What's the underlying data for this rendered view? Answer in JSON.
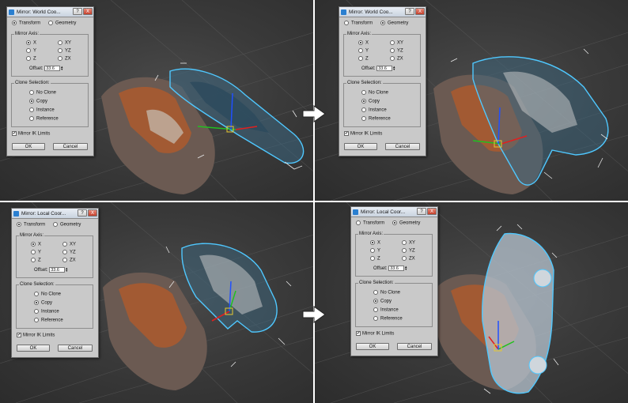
{
  "colors": {
    "viewport_bg": "#3a3a3a",
    "car_body": "#6b5a52",
    "car_interior": "#a85a30",
    "selection_blue": "#4fc8ff",
    "gizmo_x": "#e02020",
    "gizmo_y": "#20c020",
    "gizmo_z": "#2050ff",
    "gizmo_plane": "#e6c830"
  },
  "arrow_icon": "right-arrow-icon",
  "panels": [
    {
      "title": "Mirror: World Coo...",
      "mode": "transform",
      "axis": "x",
      "clone": "copy",
      "offset": "33.6",
      "ik": true
    },
    {
      "title": "Mirror: World Coo...",
      "mode": "geometry",
      "axis": "x",
      "clone": "copy",
      "offset": "33.6",
      "ik": true
    },
    {
      "title": "Mirror: Local Coor...",
      "mode": "transform",
      "axis": "x",
      "clone": "copy",
      "offset": "33.6",
      "ik": true
    },
    {
      "title": "Mirror: Local Coor...",
      "mode": "geometry",
      "axis": "x",
      "clone": "copy",
      "offset": "33.6",
      "ik": true
    }
  ],
  "labels": {
    "help": "?",
    "close": "X",
    "transform": "Transform",
    "geometry": "Geometry",
    "mirror_axis": "Mirror Axis:",
    "x": "X",
    "y": "Y",
    "z": "Z",
    "xy": "XY",
    "yz": "YZ",
    "zx": "ZX",
    "offset": "Offset:",
    "clone_selection": "Clone Selection:",
    "no_clone": "No Clone",
    "copy": "Copy",
    "instance": "Instance",
    "reference": "Reference",
    "mirror_ik": "Mirror IK Limits",
    "ok": "OK",
    "cancel": "Cancel"
  }
}
